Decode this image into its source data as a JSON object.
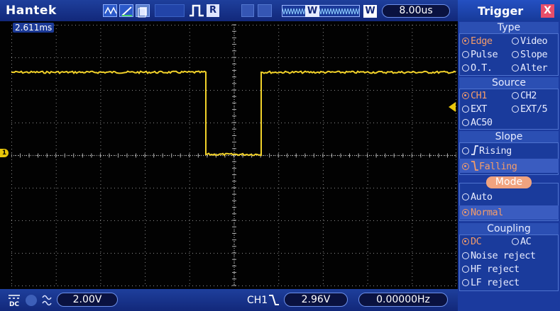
{
  "header": {
    "brand": "Hantek",
    "run_indicator": "R",
    "memory_marker": "W",
    "timebase_mode": "W",
    "timebase": "8.00us"
  },
  "screen": {
    "trigger_time": "2.611ms",
    "ch1_marker": "1"
  },
  "trigger_panel": {
    "title": "Trigger",
    "close": "X",
    "type": {
      "title": "Type",
      "options": [
        {
          "label": "Edge",
          "selected": true
        },
        {
          "label": "Video",
          "selected": false
        },
        {
          "label": "Pulse",
          "selected": false
        },
        {
          "label": "Slope",
          "selected": false
        },
        {
          "label": "O.T.",
          "selected": false
        },
        {
          "label": "Alter",
          "selected": false
        }
      ]
    },
    "source": {
      "title": "Source",
      "options": [
        {
          "label": "CH1",
          "selected": true
        },
        {
          "label": "CH2",
          "selected": false
        },
        {
          "label": "EXT",
          "selected": false
        },
        {
          "label": "EXT/5",
          "selected": false
        },
        {
          "label": "AC50",
          "selected": false
        }
      ]
    },
    "slope": {
      "title": "Slope",
      "options": [
        {
          "label": "Rising",
          "selected": false
        },
        {
          "label": "Falling",
          "selected": true
        }
      ]
    },
    "mode": {
      "title": "Mode",
      "options": [
        {
          "label": "Auto",
          "selected": false
        },
        {
          "label": "Normal",
          "selected": true
        }
      ]
    },
    "coupling": {
      "title": "Coupling",
      "options": [
        {
          "label": "DC",
          "selected": true
        },
        {
          "label": "AC",
          "selected": false
        },
        {
          "label": "Noise reject",
          "selected": false
        },
        {
          "label": "HF reject",
          "selected": false
        },
        {
          "label": "LF reject",
          "selected": false
        }
      ]
    }
  },
  "footer": {
    "coupling_icon": "DC",
    "volts_per_div": "2.00V",
    "trigger_channel": "CH1",
    "trigger_level": "2.96V",
    "frequency": "0.00000Hz"
  },
  "colors": {
    "trace": "#f2d22a",
    "grid": "#8c8c8c",
    "panel": "#1b3a9e",
    "selected_option": "#f39c6b",
    "mode_highlight": "#f0a37f"
  },
  "icons": [
    "waveform-icon",
    "edit-icon",
    "copy-icon",
    "run-pulse-icon",
    "falling-edge-icon",
    "close-icon"
  ]
}
